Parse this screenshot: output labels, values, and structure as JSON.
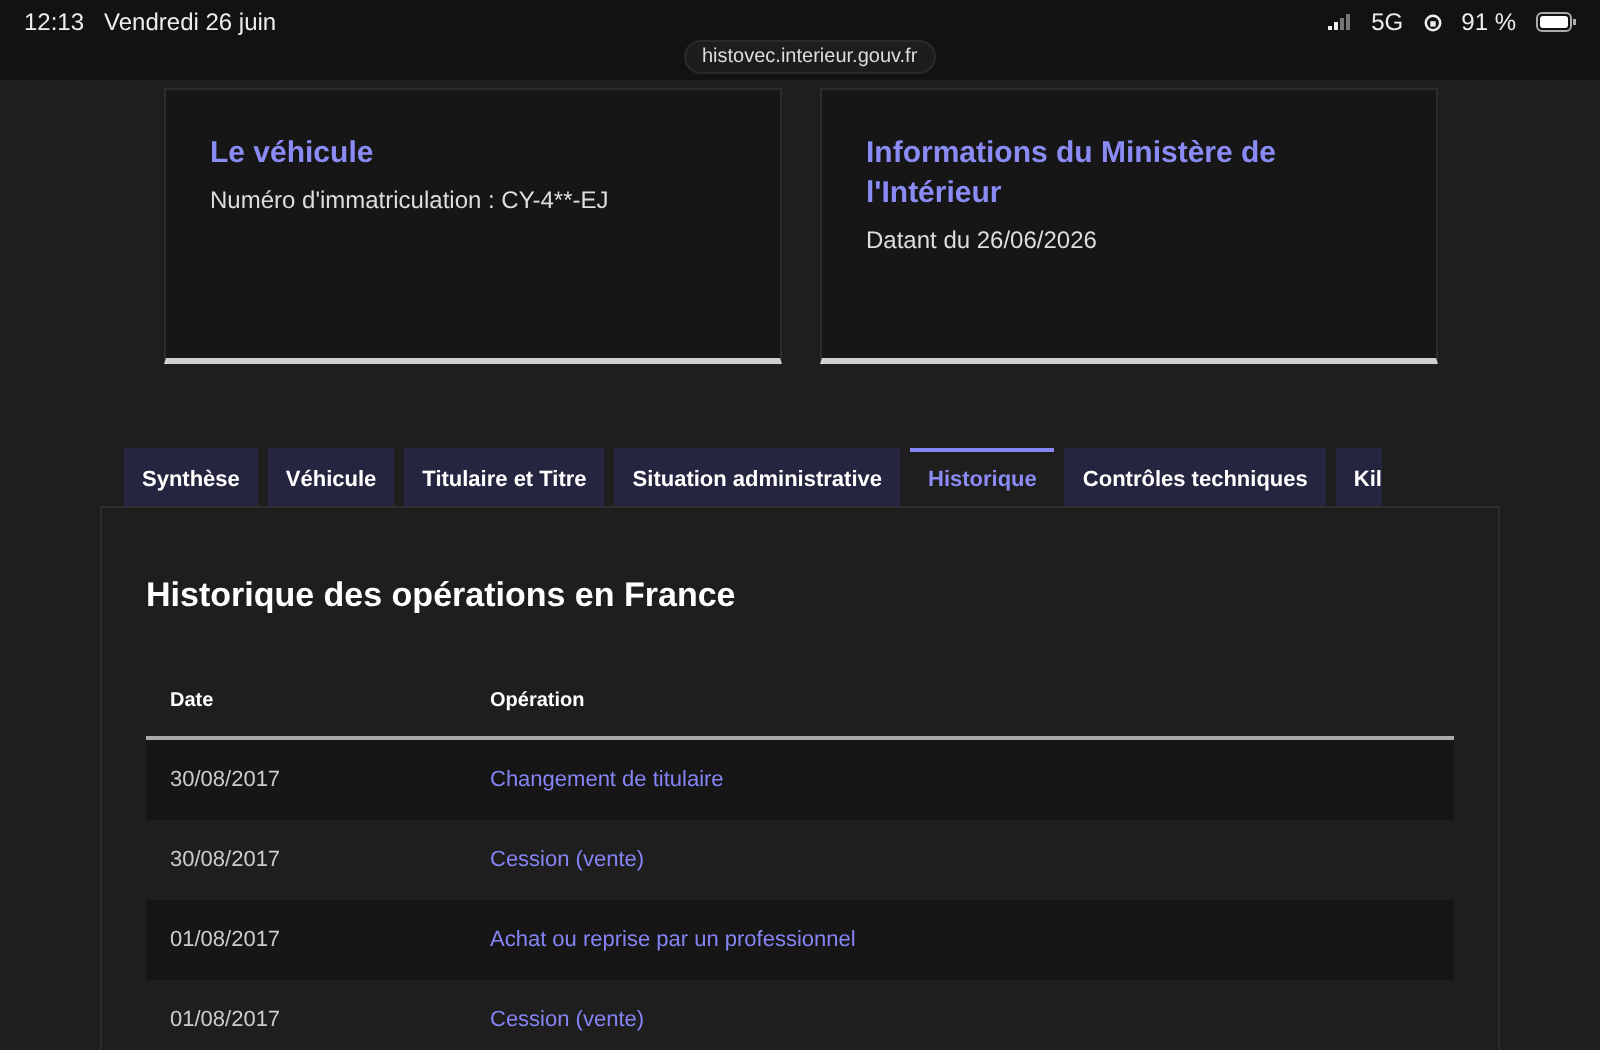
{
  "status_bar": {
    "time": "12:13",
    "date": "Vendredi 26 juin",
    "network": "5G",
    "battery": "91 %"
  },
  "address_bar": {
    "url": "histovec.interieur.gouv.fr"
  },
  "cards": [
    {
      "title": "Le véhicule",
      "text": "Numéro d'immatriculation : CY-4**-EJ"
    },
    {
      "title": "Informations du Ministère de l'Intérieur",
      "text": "Datant du 26/06/2026"
    }
  ],
  "tabs": [
    {
      "label": "Synthèse",
      "selected": false
    },
    {
      "label": "Véhicule",
      "selected": false
    },
    {
      "label": "Titulaire et Titre",
      "selected": false
    },
    {
      "label": "Situation administrative",
      "selected": false
    },
    {
      "label": "Historique",
      "selected": true
    },
    {
      "label": "Contrôles techniques",
      "selected": false
    },
    {
      "label": "Kil",
      "selected": false
    }
  ],
  "panel": {
    "title": "Historique des opérations en France",
    "table": {
      "columns": [
        "Date",
        "Opération"
      ],
      "rows": [
        {
          "date": "30/08/2017",
          "operation": "Changement de titulaire"
        },
        {
          "date": "30/08/2017",
          "operation": "Cession (vente)"
        },
        {
          "date": "01/08/2017",
          "operation": "Achat ou reprise par un professionnel"
        },
        {
          "date": "01/08/2017",
          "operation": "Cession (vente)"
        }
      ]
    }
  }
}
